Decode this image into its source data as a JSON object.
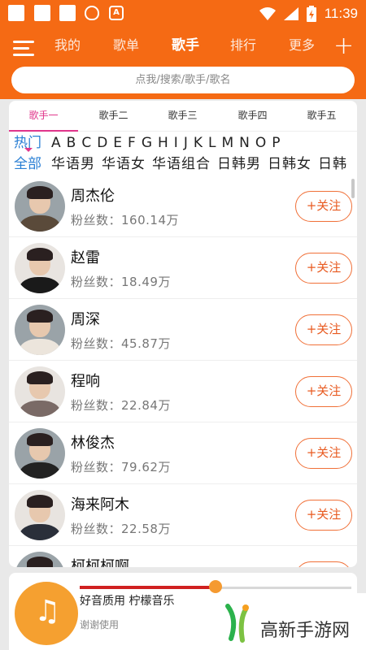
{
  "status_bar": {
    "time": "11:39",
    "icons": [
      "app-square-icon",
      "app-square-icon",
      "app-square-icon",
      "shield-icon",
      "a-letter-icon",
      "wifi-icon",
      "signal-icon",
      "battery-icon"
    ]
  },
  "header": {
    "nav": [
      "我的",
      "歌单",
      "歌手",
      "排行",
      "更多"
    ],
    "active_nav": "歌手",
    "search_placeholder": "点我/搜索/歌手/歌名"
  },
  "tabs": [
    "歌手一",
    "歌手二",
    "歌手三",
    "歌手四",
    "歌手五"
  ],
  "filters": {
    "letter_label": "热门",
    "letters": [
      "A",
      "B",
      "C",
      "D",
      "E",
      "F",
      "G",
      "H",
      "I",
      "J",
      "K",
      "L",
      "M",
      "N",
      "O",
      "P"
    ],
    "category_label": "全部",
    "categories": [
      "华语男",
      "华语女",
      "华语组合",
      "日韩男",
      "日韩女",
      "日韩"
    ]
  },
  "singers": [
    {
      "name": "周杰伦",
      "fans": "粉丝数：160.14万",
      "follow": "+关注"
    },
    {
      "name": "赵雷",
      "fans": "粉丝数：18.49万",
      "follow": "+关注"
    },
    {
      "name": "周深",
      "fans": "粉丝数：45.87万",
      "follow": "+关注"
    },
    {
      "name": "程响",
      "fans": "粉丝数：22.84万",
      "follow": "+关注"
    },
    {
      "name": "林俊杰",
      "fans": "粉丝数：79.62万",
      "follow": "+关注"
    },
    {
      "name": "海来阿木",
      "fans": "粉丝数：22.58万",
      "follow": "+关注"
    },
    {
      "name": "柯柯柯啊",
      "fans": "",
      "follow": "+关注"
    }
  ],
  "player": {
    "title": "好音质用 柠檬音乐",
    "subtitle": "谢谢使用",
    "progress": 0.5
  },
  "watermark": {
    "text": "高新手游网"
  },
  "colors": {
    "accent": "#f56a14",
    "tab_active": "#e0358b",
    "follow": "#e85a20",
    "link": "#2a7fd4"
  }
}
